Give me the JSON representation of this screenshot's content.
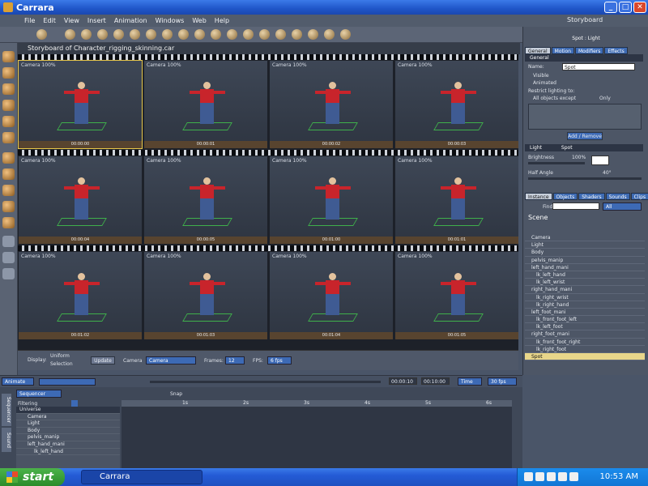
{
  "app": {
    "title": "Carrara",
    "buttons": {
      "minimize": "_",
      "maximize": "□",
      "close": "✕"
    }
  },
  "menu": {
    "items": [
      "File",
      "Edit",
      "View",
      "Insert",
      "Animation",
      "Windows",
      "Web",
      "Help"
    ],
    "storyboard": "Storyboard"
  },
  "storyboard": {
    "title": "Storyboard of Character_rigging_skinning.car",
    "rows": [
      {
        "cells": [
          {
            "label": "Camera 100%",
            "tc": "00:00:00"
          },
          {
            "label": "Camera 100%",
            "tc": "00:00:01"
          },
          {
            "label": "Camera 100%",
            "tc": "00:00:02"
          },
          {
            "label": "Camera 100%",
            "tc": "00:00:03"
          }
        ]
      },
      {
        "cells": [
          {
            "label": "Camera 100%",
            "tc": "00:00:04"
          },
          {
            "label": "Camera 100%",
            "tc": "00:00:05"
          },
          {
            "label": "Camera 100%",
            "tc": "00:01:00"
          },
          {
            "label": "Camera 100%",
            "tc": "00:01:01"
          }
        ]
      },
      {
        "cells": [
          {
            "label": "Camera 100%",
            "tc": "00:01:02"
          },
          {
            "label": "Camera 100%",
            "tc": "00:01:03"
          },
          {
            "label": "Camera 100%",
            "tc": "00:01:04"
          },
          {
            "label": "Camera 100%",
            "tc": "00:01:05"
          }
        ]
      }
    ],
    "display_label": "Display:",
    "display_uniform": "Uniform",
    "display_selection": "Selection",
    "update_button": "Update",
    "camera_label": "Camera",
    "camera_value": "Camera",
    "frames_label": "Frames:",
    "frames_value": "12",
    "fps_label": "FPS:",
    "fps_value": "6 fps"
  },
  "timebar": {
    "mode": "Animate",
    "time_start": "00:00:10",
    "time_end": "00:10:00",
    "time_label": "Time",
    "fps": "30 fps"
  },
  "sequencer": {
    "mode": "Sequencer",
    "filter": "Filtering",
    "snap": "Snap",
    "side_tabs": [
      "Sequencer",
      "Sound"
    ],
    "tree": [
      "Universe",
      "Camera",
      "Light",
      "Body",
      "pelvis_manip",
      "left_hand_mani",
      "lk_left_hand"
    ],
    "ruler": [
      "1s",
      "2s",
      "3s",
      "4s",
      "5s",
      "6s"
    ]
  },
  "right": {
    "title": "Spot : Light",
    "tabs": [
      "General",
      "Motion",
      "Modifiers",
      "Effects"
    ],
    "general_header": "General",
    "name_label": "Name:",
    "name_value": "Spot",
    "visible": "Visible",
    "animated": "Animated",
    "restrict": "Restrict lighting to:",
    "all_except": "All objects except",
    "only": "Only",
    "add_remove": "Add / Remove",
    "light_header": "Light",
    "light_type": "Spot",
    "brightness_label": "Brightness",
    "brightness_value": "100%",
    "half_angle_label": "Half Angle",
    "half_angle_value": "40°",
    "lib_tabs": [
      "Instance",
      "Objects",
      "Shaders",
      "Sounds",
      "Clips"
    ],
    "find_label": "Find:",
    "find_scope": "All",
    "scene": "Scene",
    "tree": [
      "Camera",
      "Light",
      "Body",
      "pelvis_manip",
      "left_hand_mani",
      "lk_left_hand",
      "lk_left_wrist",
      "right_hand_mani",
      "lk_right_wrist",
      "lk_right_hand",
      "left_foot_mani",
      "lk_front_foot_left",
      "lk_left_foot",
      "right_foot_mani",
      "lk_front_foot_right",
      "lk_right_foot",
      "Spot"
    ]
  },
  "taskbar": {
    "start": "start",
    "item": "Carrara",
    "clock": "10:53 AM"
  }
}
